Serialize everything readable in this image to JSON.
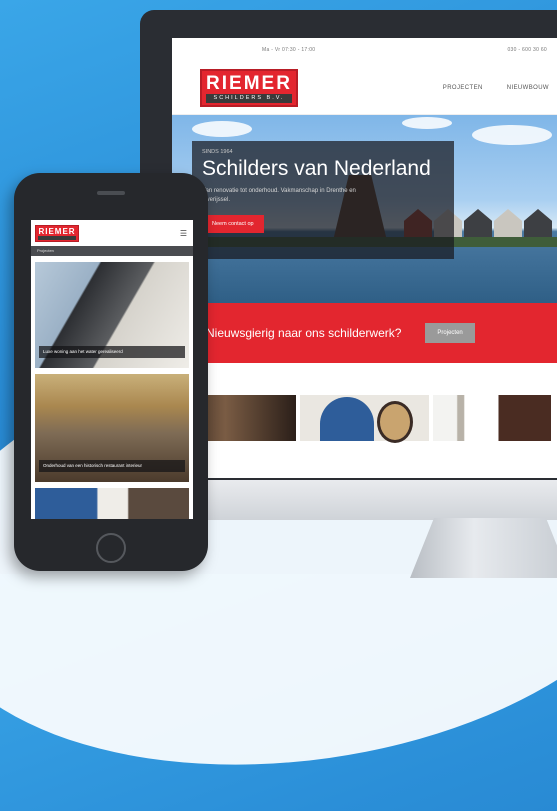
{
  "desktop": {
    "topbar": {
      "hours": "Ma - Vr 07:30 - 17:00",
      "phone": "030 - 600 30 60"
    },
    "logo": {
      "brand": "RIEMER",
      "sub": "SCHILDERS B.V."
    },
    "nav": [
      "PROJECTEN",
      "NIEUWBOUW"
    ],
    "hero": {
      "eyebrow": "SINDS 1964",
      "title": "Schilders van Nederland",
      "text": "Van renovatie tot onderhoud. Vakmanschap in Drenthe en Overijssel.",
      "button": "Neem contact op"
    },
    "cta": {
      "text": "Nieuwsgierig naar ons schilderwerk?",
      "button": "Projecten"
    }
  },
  "mobile": {
    "logo": {
      "brand": "RIEMER"
    },
    "menu_icon": "hamburger-icon",
    "breadcrumb": "Projecten",
    "cards": [
      {
        "caption": "Luxe woning aan het water gerealiseerd"
      },
      {
        "caption": "Onderhoud van een historisch restaurant interieur"
      },
      {
        "caption": ""
      }
    ]
  },
  "colors": {
    "brand_red": "#e3262f",
    "background_blue": "#2b8fd8",
    "device_dark": "#26282c"
  }
}
